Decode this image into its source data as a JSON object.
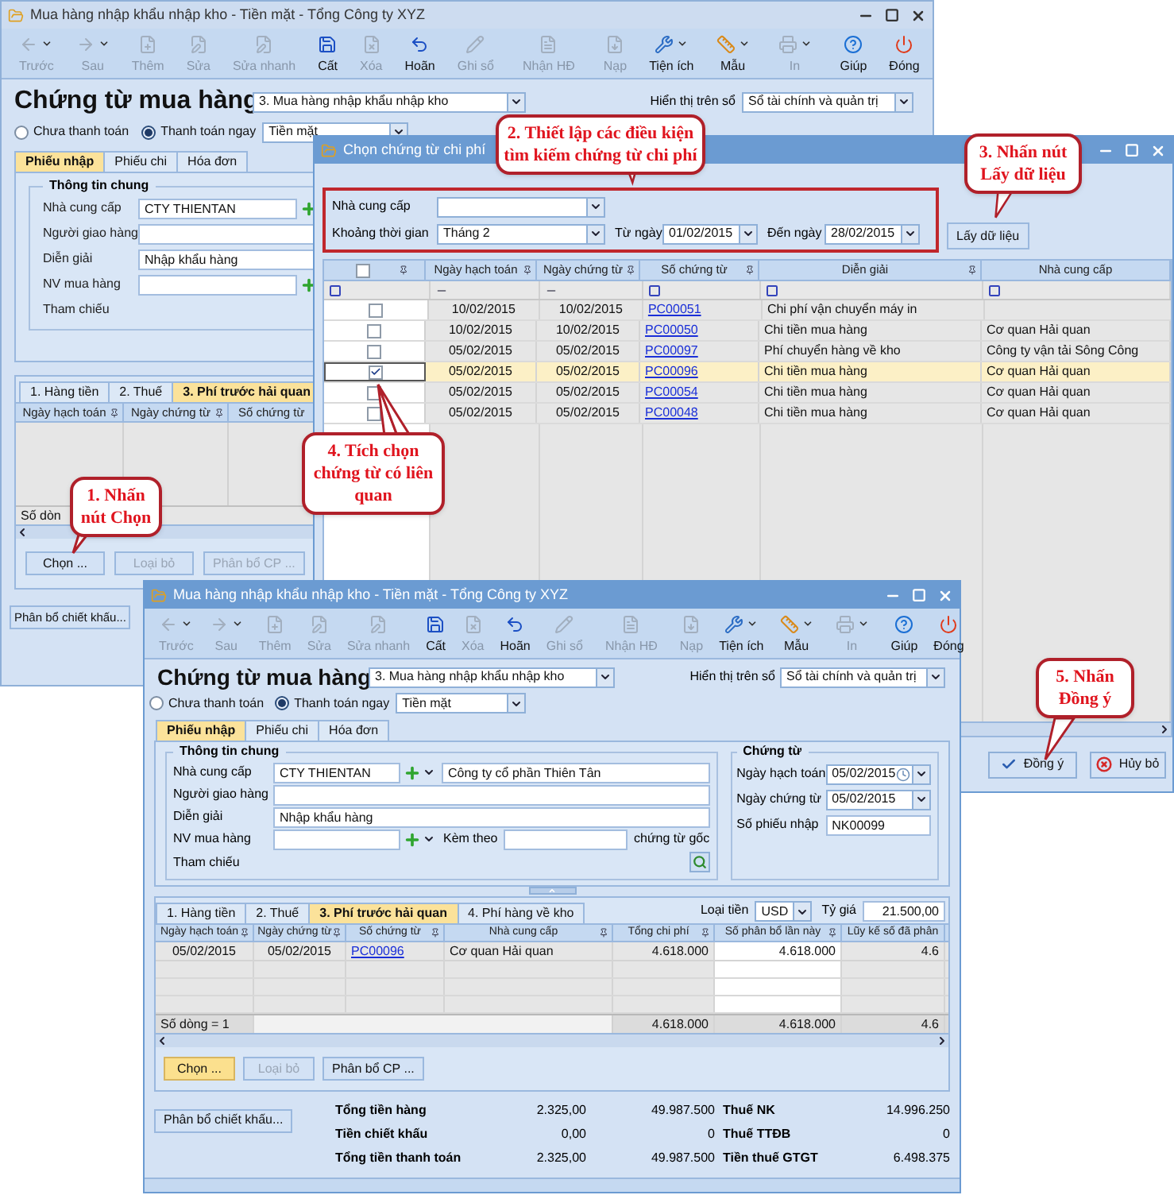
{
  "back_window": {
    "title": "Mua hàng nhập khẩu nhập kho - Tiền mặt - Tổng Công ty XYZ",
    "toolbar": [
      {
        "kind": "button",
        "label": "Trước",
        "disabled": true,
        "dropdown": true
      },
      {
        "kind": "button",
        "label": "Sau",
        "disabled": true,
        "dropdown": true
      },
      {
        "kind": "button",
        "label": "Thêm",
        "disabled": true,
        "dropdown": false
      },
      {
        "kind": "button",
        "label": "Sửa",
        "disabled": true,
        "dropdown": false
      },
      {
        "kind": "button",
        "label": "Sửa nhanh",
        "disabled": true,
        "dropdown": false
      },
      {
        "kind": "button",
        "label": "Cất",
        "disabled": false,
        "dropdown": false
      },
      {
        "kind": "button",
        "label": "Xóa",
        "disabled": true,
        "dropdown": false
      },
      {
        "kind": "button",
        "label": "Hoãn",
        "disabled": false,
        "dropdown": false
      },
      {
        "kind": "button",
        "label": "Ghi sổ",
        "disabled": true,
        "dropdown": false
      },
      {
        "kind": "separator"
      },
      {
        "kind": "button",
        "label": "Nhận HĐ",
        "disabled": true,
        "dropdown": false
      },
      {
        "kind": "separator"
      },
      {
        "kind": "button",
        "label": "Nạp",
        "disabled": true,
        "dropdown": false
      },
      {
        "kind": "button",
        "label": "Tiện ích",
        "disabled": false,
        "dropdown": true
      },
      {
        "kind": "button",
        "label": "Mẫu",
        "disabled": false,
        "dropdown": true
      },
      {
        "kind": "separator"
      },
      {
        "kind": "button",
        "label": "In",
        "disabled": true,
        "dropdown": true
      },
      {
        "kind": "separator"
      },
      {
        "kind": "button",
        "label": "Giúp",
        "disabled": false,
        "dropdown": false
      },
      {
        "kind": "button",
        "label": "Đóng",
        "disabled": false,
        "dropdown": false
      }
    ],
    "heading": "Chứng từ mua hàng",
    "voucher_type": "3. Mua hàng nhập khẩu nhập kho",
    "ledger_label": "Hiển thị trên sổ",
    "ledger": "Sổ tài chính và quản trị",
    "payment_options": [
      {
        "label": "Chưa thanh toán",
        "selected": false
      },
      {
        "label": "Thanh toán ngay",
        "selected": true
      }
    ],
    "payment_method": "Tiền mặt",
    "tabs": [
      {
        "label": "Phiếu nhập",
        "selected": true
      },
      {
        "label": "Phiếu chi",
        "selected": false
      },
      {
        "label": "Hóa đơn",
        "selected": false
      }
    ],
    "group_title": "Thông tin chung",
    "fields": [
      {
        "label": "Nhà cung cấp",
        "kind": "input",
        "value": "CTY THIENTAN",
        "add_button": true
      },
      {
        "label": "Người giao hàng",
        "kind": "input",
        "add_button": false
      },
      {
        "label": "Diễn giải",
        "kind": "input",
        "value": "Nhập khẩu hàng",
        "add_button": false
      },
      {
        "label": "NV mua hàng",
        "kind": "input",
        "add_button": true
      },
      {
        "label": "Tham chiếu",
        "kind": "plain",
        "add_button": false
      }
    ],
    "detail_tabs": [
      {
        "label": "1. Hàng tiền",
        "selected": false
      },
      {
        "label": "2. Thuế",
        "selected": false
      },
      {
        "label": "3. Phí trước hải quan",
        "selected": true
      }
    ],
    "columns": [
      "Ngày hạch toán",
      "Ngày chứng từ",
      "Số chứng từ"
    ],
    "row_count": "Số dòn",
    "buttons": [
      {
        "label": "Chọn ...",
        "disabled": false
      },
      {
        "label": "Loại bỏ",
        "disabled": true
      },
      {
        "label": "Phân bổ CP ...",
        "disabled": true
      }
    ],
    "discount_button": "Phân bổ chiết khấu..."
  },
  "dialog": {
    "title": "Chọn chứng từ chi phí",
    "supplier_label": "Nhà cung cấp",
    "period_label": "Khoảng thời gian",
    "period": "Tháng 2",
    "from_label": "Từ ngày",
    "from": "01/02/2015",
    "to_label": "Đến ngày",
    "to": "28/02/2015",
    "fetch_button": "Lấy dữ liệu",
    "select_all": {
      "checked": false
    },
    "columns": [
      "Ngày hạch toán",
      "Ngày chứng từ",
      "Số chứng từ",
      "Diễn giải",
      "Nhà cung cấp"
    ],
    "rows": [
      {
        "checked": false,
        "selected": false,
        "posting_date": "10/02/2015",
        "document_date": "10/02/2015",
        "document_no": "PC00051",
        "description": "Chi phí vận chuyển máy in"
      },
      {
        "checked": false,
        "selected": false,
        "posting_date": "10/02/2015",
        "document_date": "10/02/2015",
        "document_no": "PC00050",
        "description": "Chi tiền mua hàng",
        "supplier": "Cơ quan Hải quan"
      },
      {
        "checked": false,
        "selected": false,
        "posting_date": "05/02/2015",
        "document_date": "05/02/2015",
        "document_no": "PC00097",
        "description": "Phí chuyển hàng về kho",
        "supplier": "Công ty vận tải Sông Công"
      },
      {
        "checked": true,
        "selected": true,
        "posting_date": "05/02/2015",
        "document_date": "05/02/2015",
        "document_no": "PC00096",
        "description": "Chi tiền mua hàng",
        "supplier": "Cơ quan Hải quan"
      },
      {
        "checked": false,
        "selected": false,
        "posting_date": "05/02/2015",
        "document_date": "05/02/2015",
        "document_no": "PC00054",
        "description": "Chi tiền mua hàng",
        "supplier": "Cơ quan Hải quan"
      },
      {
        "checked": false,
        "selected": false,
        "posting_date": "05/02/2015",
        "document_date": "05/02/2015",
        "document_no": "PC00048",
        "description": "Chi tiền mua hàng",
        "supplier": "Cơ quan Hải quan"
      }
    ],
    "ok_button": "Đồng ý",
    "cancel_button": "Hủy bỏ"
  },
  "front_window": {
    "title": "Mua hàng nhập khẩu nhập kho - Tiền mặt - Tổng Công ty XYZ",
    "toolbar": [
      {
        "kind": "button",
        "label": "Trước",
        "disabled": true,
        "dropdown": true
      },
      {
        "kind": "button",
        "label": "Sau",
        "disabled": true,
        "dropdown": true
      },
      {
        "kind": "button",
        "label": "Thêm",
        "disabled": true,
        "dropdown": false
      },
      {
        "kind": "button",
        "label": "Sửa",
        "disabled": true,
        "dropdown": false
      },
      {
        "kind": "button",
        "label": "Sửa nhanh",
        "disabled": true,
        "dropdown": false
      },
      {
        "kind": "button",
        "label": "Cất",
        "disabled": false,
        "dropdown": false
      },
      {
        "kind": "button",
        "label": "Xóa",
        "disabled": true,
        "dropdown": false
      },
      {
        "kind": "button",
        "label": "Hoãn",
        "disabled": false,
        "dropdown": false
      },
      {
        "kind": "button",
        "label": "Ghi sổ",
        "disabled": true,
        "dropdown": false
      },
      {
        "kind": "separator"
      },
      {
        "kind": "button",
        "label": "Nhận HĐ",
        "disabled": true,
        "dropdown": false
      },
      {
        "kind": "separator"
      },
      {
        "kind": "button",
        "label": "Nạp",
        "disabled": true,
        "dropdown": false
      },
      {
        "kind": "button",
        "label": "Tiện ích",
        "disabled": false,
        "dropdown": true
      },
      {
        "kind": "button",
        "label": "Mẫu",
        "disabled": false,
        "dropdown": true
      },
      {
        "kind": "separator"
      },
      {
        "kind": "button",
        "label": "In",
        "disabled": true,
        "dropdown": true
      },
      {
        "kind": "separator"
      },
      {
        "kind": "button",
        "label": "Giúp",
        "disabled": false,
        "dropdown": false
      },
      {
        "kind": "button",
        "label": "Đóng",
        "disabled": false,
        "dropdown": false
      }
    ],
    "heading": "Chứng từ mua hàng",
    "voucher_type": "3. Mua hàng nhập khẩu nhập kho",
    "ledger_label": "Hiển thị trên sổ",
    "ledger": "Sổ tài chính và quản trị",
    "payment_options": [
      {
        "label": "Chưa thanh toán",
        "selected": false
      },
      {
        "label": "Thanh toán ngay",
        "selected": true
      }
    ],
    "payment_method": "Tiền mặt",
    "tabs": [
      {
        "label": "Phiếu nhập",
        "selected": true
      },
      {
        "label": "Phiếu chi",
        "selected": false
      },
      {
        "label": "Hóa đơn",
        "selected": false
      }
    ],
    "general": {
      "title": "Thông tin chung",
      "supplier_label": "Nhà cung cấp",
      "supplier_code": "CTY THIENTAN",
      "supplier_name": "Công ty cổ phần Thiên Tân",
      "deliverer_label": "Người giao hàng",
      "description_label": "Diễn giải",
      "description": "Nhập khẩu hàng",
      "buyer_label": "NV mua hàng",
      "attached_label": "Kèm theo",
      "attached_suffix": "chứng từ gốc",
      "reference_label": "Tham chiếu"
    },
    "document": {
      "title": "Chứng từ",
      "fields": [
        {
          "label": "Ngày hạch toán",
          "value": "05/02/2015",
          "kind": "date_picker"
        },
        {
          "label": "Ngày chứng từ",
          "value": "05/02/2015",
          "kind": "date"
        },
        {
          "label": "Số phiếu nhập",
          "value": "NK00099",
          "kind": "text"
        }
      ]
    },
    "currency_label": "Loại tiền",
    "currency": "USD",
    "rate_label": "Tỷ giá",
    "rate": "21.500,00",
    "detail_tabs": [
      {
        "label": "1. Hàng tiền",
        "selected": false
      },
      {
        "label": "2. Thuế",
        "selected": false
      },
      {
        "label": "3. Phí trước hải quan",
        "selected": true
      },
      {
        "label": "4. Phí hàng về kho",
        "selected": false
      }
    ],
    "columns": [
      "Ngày hạch toán",
      "Ngày chứng từ",
      "Số chứng từ",
      "Nhà cung cấp",
      "Tổng chi phí",
      "Số phân bổ lần này",
      "Lũy kế số đã phân"
    ],
    "rows": [
      {
        "posting_date": "05/02/2015",
        "document_date": "05/02/2015",
        "document_no": "PC00096",
        "supplier": "Cơ quan Hải quan",
        "total": "4.618.000",
        "allocated": "4.618.000",
        "accumulated": "4.6"
      }
    ],
    "footer": {
      "row_count": "Số dòng = 1",
      "total": "4.618.000",
      "allocated": "4.618.000",
      "accumulated": "4.6"
    },
    "buttons": [
      {
        "label": "Chọn ...",
        "disabled": false,
        "highlighted": true
      },
      {
        "label": "Loại bỏ",
        "disabled": true,
        "highlighted": false
      },
      {
        "label": "Phân bổ CP ...",
        "disabled": false,
        "highlighted": false
      }
    ],
    "discount_button": "Phân bổ chiết khấu...",
    "totals": [
      {
        "label": "Tổng tiền hàng",
        "foreign": "2.325,00",
        "local": "49.987.500",
        "tax_label": "Thuế NK",
        "tax": "14.996.250"
      },
      {
        "label": "Tiền chiết khấu",
        "foreign": "0,00",
        "local": "0",
        "tax_label": "Thuế TTĐB",
        "tax": "0"
      },
      {
        "label": "Tổng tiền thanh toán",
        "foreign": "2.325,00",
        "local": "49.987.500",
        "tax_label": "Tiền thuế GTGT",
        "tax": "6.498.375"
      }
    ]
  },
  "callouts": [
    {
      "lines": [
        "1. Nhấn",
        "nút Chọn"
      ]
    },
    {
      "lines": [
        "2. Thiết lập các điều kiện",
        "tìm kiếm chứng từ chi phí"
      ]
    },
    {
      "lines": [
        "3. Nhấn nút",
        "Lấy dữ liệu"
      ]
    },
    {
      "lines": [
        "4. Tích chọn",
        "chứng từ có liên",
        "quan"
      ]
    },
    {
      "lines": [
        "5. Nhấn",
        "Đồng ý"
      ]
    }
  ]
}
